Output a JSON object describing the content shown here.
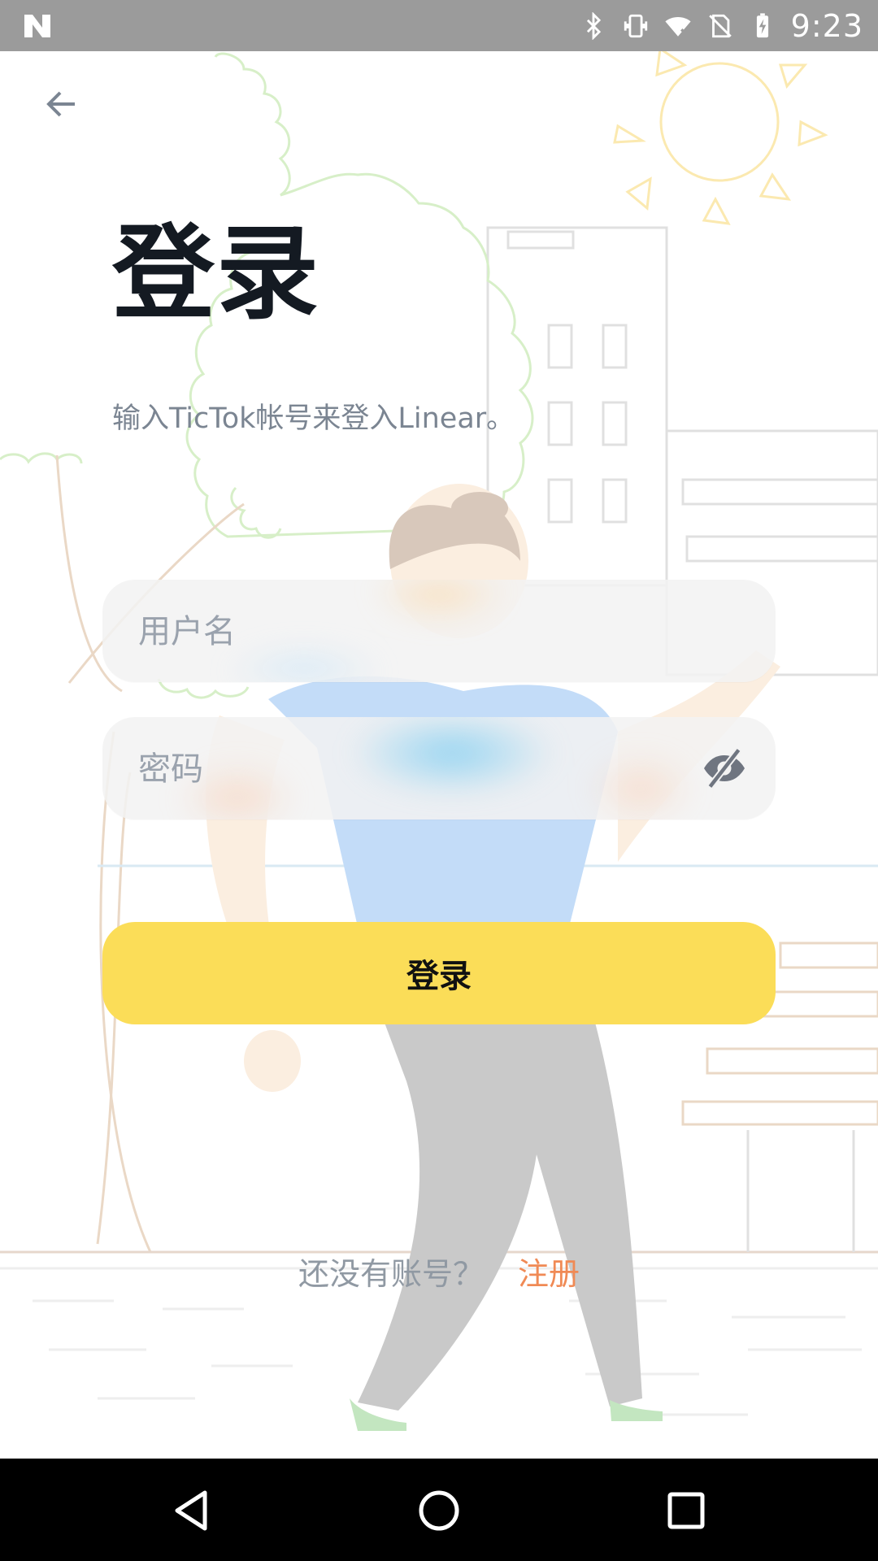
{
  "status_bar": {
    "time": "9:23",
    "icons": [
      "notification-n-icon",
      "bluetooth-icon",
      "vibrate-icon",
      "wifi-off-icon",
      "no-sim-icon",
      "battery-charging-icon"
    ]
  },
  "header": {
    "back_icon": "arrow-left-icon",
    "title": "登录",
    "subtitle": "输入TicTok帐号来登入Linear。"
  },
  "form": {
    "username_placeholder": "用户名",
    "username_value": "",
    "password_placeholder": "密码",
    "password_value": "",
    "password_toggle_icon": "eye-off-icon",
    "submit_label": "登录"
  },
  "footer": {
    "prompt": "还没有账号？",
    "signup_label": "注册"
  },
  "colors": {
    "accent": "#fbdd58",
    "link": "#f08a55",
    "title": "#141a22",
    "muted": "#7b8592",
    "status_bar": "#9b9b9b"
  },
  "nav_bar": {
    "icons": [
      "nav-back-icon",
      "nav-home-icon",
      "nav-recents-icon"
    ]
  }
}
